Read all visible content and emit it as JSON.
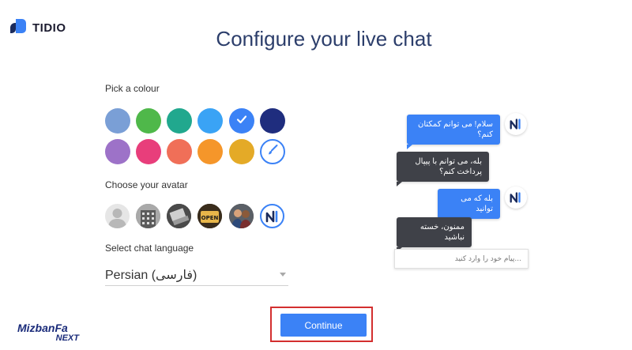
{
  "brand": {
    "name": "TIDIO"
  },
  "title": "Configure your live chat",
  "colour_section": {
    "label": "Pick a colour",
    "swatches": [
      {
        "color": "#7a9fd6"
      },
      {
        "color": "#4fb84a"
      },
      {
        "color": "#21a88e"
      },
      {
        "color": "#3aa3f5"
      },
      {
        "color": "#3b82f6",
        "selected": true
      },
      {
        "color": "#1f2d7e"
      },
      {
        "color": "#9d72c8"
      },
      {
        "color": "#e83e7b"
      },
      {
        "color": "#f06f58"
      },
      {
        "color": "#f5962a"
      },
      {
        "color": "#e4aa27"
      },
      {
        "color": "custom"
      }
    ]
  },
  "avatar_section": {
    "label": "Choose your avatar",
    "avatars": [
      "default-person-avatar",
      "building-photo-avatar",
      "laptop-photo-avatar",
      "open-sign-avatar",
      "people-photo-avatar",
      "tidio-logo-avatar"
    ]
  },
  "language_section": {
    "label": "Select chat language",
    "selected": "Persian (فارسی)"
  },
  "continue_label": "Continue",
  "chat_preview": {
    "messages": [
      {
        "from": "operator",
        "text": "سلام! می توانم کمکتان کنم؟"
      },
      {
        "from": "visitor",
        "text": "بله، می توانم با پیپال پرداخت کنم؟"
      },
      {
        "from": "operator",
        "text": "بله که می توانید"
      },
      {
        "from": "visitor",
        "text": "ممنون، خسته نباشید"
      }
    ],
    "input_placeholder": "...پیام خود را وارد کنید"
  },
  "watermark": {
    "line1": "MizbanFa",
    "line2": "NEXT"
  },
  "accent_color": "#3b82f6",
  "highlight_color": "#d32f2f"
}
